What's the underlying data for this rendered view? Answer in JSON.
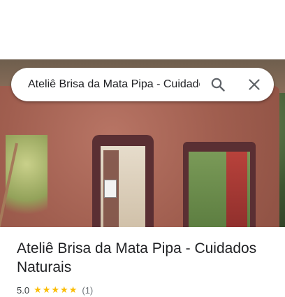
{
  "search": {
    "query": "Ateliê Brisa da Mata Pipa - Cuidados Naturais"
  },
  "icons": {
    "search": "search-icon",
    "close": "close-icon"
  },
  "place": {
    "title": "Ateliê Brisa da Mata Pipa - Cuidados Naturais",
    "rating": "5.0",
    "stars": "★★★★★",
    "review_count": "(1)"
  },
  "colors": {
    "star": "#fbbc04",
    "icon": "#5f6368",
    "title_text": "#202124"
  }
}
